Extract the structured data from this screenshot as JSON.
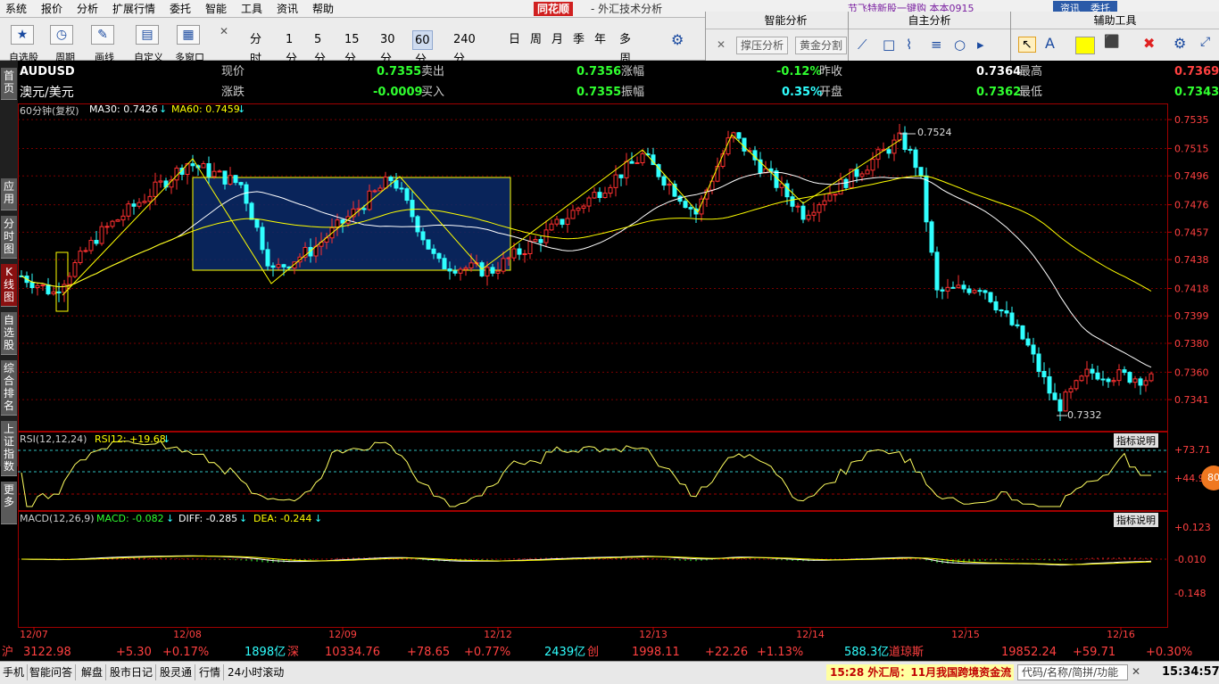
{
  "menu": {
    "items": [
      "系统",
      "报价",
      "分析",
      "扩展行情",
      "委托",
      "智能",
      "工具",
      "资讯",
      "帮助"
    ],
    "logo": "同花顺",
    "window_title": "- 外汇技术分析",
    "news": "节飞特新股一键购   本本0915",
    "tab1": "资讯",
    "tab2": "委托"
  },
  "toolbar": {
    "groups": [
      {
        "label": "自选股",
        "icon": "star-icon"
      },
      {
        "label": "周期",
        "icon": "clock-icon"
      },
      {
        "label": "画线",
        "icon": "pencil-icon"
      },
      {
        "label": "自定义",
        "icon": "layout-icon"
      },
      {
        "label": "多窗口",
        "icon": "windows-icon"
      }
    ]
  },
  "periods": [
    "分时",
    "1分",
    "5分",
    "15分",
    "30分",
    "60分",
    "240分钟",
    "日",
    "周",
    "月",
    "季",
    "年",
    "多周期"
  ],
  "selected_period": "60分",
  "panels": {
    "smart": {
      "title": "智能分析",
      "b1": "撑压分析",
      "b2": "黄金分割"
    },
    "self": {
      "title": "自主分析"
    },
    "aux": {
      "title": "辅助工具"
    }
  },
  "sidetabs": [
    "首页",
    "应用",
    "分时图",
    "K线图",
    "自选股",
    "综合排名",
    "上证指数",
    "更多"
  ],
  "quote": {
    "code": "AUDUSD",
    "name": "澳元/美元",
    "l_now": "现价",
    "v_now": "0.7355",
    "l_sell": "卖出",
    "v_sell": "0.7356",
    "l_chg_pct": "涨幅",
    "v_chg_pct": "-0.12%",
    "l_prev": "昨收",
    "v_prev": "0.7364",
    "l_high": "最高",
    "v_high": "0.7369",
    "l_chg": "涨跌",
    "v_chg": "-0.0009",
    "l_buy": "买入",
    "v_buy": "0.7355",
    "l_amp": "振幅",
    "v_amp": "0.35%",
    "l_open": "开盘",
    "v_open": "0.7362",
    "l_low": "最低",
    "v_low": "0.7343"
  },
  "ma_label": "60分钟(复权)",
  "ma30_label": "MA30: 0.7426",
  "ma60_label": "MA60: 0.7459",
  "price_axis": [
    "0.7535",
    "0.7515",
    "0.7496",
    "0.7476",
    "0.7457",
    "0.7438",
    "0.7418",
    "0.7399",
    "0.7380",
    "0.7360",
    "0.7341"
  ],
  "annot_high": "0.7524",
  "annot_low": "0.7332",
  "rsi": {
    "label": "RSI(12,12,24)",
    "value": "RSI12: +19.68",
    "axis": [
      "+73.71",
      "+44.97"
    ],
    "help": "指标说明",
    "badge": "80"
  },
  "macd": {
    "label": "MACD(12,26,9)",
    "macd": "MACD: -0.082",
    "diff": "DIFF: -0.285",
    "dea": "DEA: -0.244",
    "axis": [
      "+0.123",
      "-0.010",
      "-0.148"
    ],
    "help": "指标说明"
  },
  "dates": [
    "12/07",
    "12/08",
    "12/09",
    "12/12",
    "12/13",
    "12/14",
    "12/15",
    "12/16"
  ],
  "colors": {
    "up": "#ff3030",
    "down": "#30ffff",
    "ma30": "#ffffff",
    "ma60": "#ffff00",
    "grid": "#7a0000"
  },
  "chart_data": {
    "type": "candlestick",
    "title": "AUDUSD 60分钟",
    "ylim": [
      0.7325,
      0.754
    ],
    "ma30_last": 0.7426,
    "ma60_last": 0.7459,
    "high": 0.7524,
    "low": 0.7332,
    "x": [
      "12/07",
      "12/08",
      "12/09",
      "12/12",
      "12/13",
      "12/14",
      "12/15",
      "12/16"
    ]
  },
  "footer": {
    "sh_l": "沪",
    "sh_v": "3122.98",
    "sh_c": "+5.30",
    "sh_p": "+0.17%",
    "sh_vol": "1898亿",
    "sz_l": "深",
    "sz_v": "10334.76",
    "sz_c": "+78.65",
    "sz_p": "+0.77%",
    "sz_vol": "2439亿",
    "cy_l": "创",
    "cy_v": "1998.11",
    "cy_c": "+22.26",
    "cy_p": "+1.13%",
    "cy_vol": "588.3亿",
    "dj_l": "道琼斯",
    "dj_v": "19852.24",
    "dj_c": "+59.71",
    "dj_p": "+0.30%"
  },
  "bottombar": {
    "items": [
      "手机",
      "智能问答",
      "解盘",
      "股市日记",
      "股灵通",
      "行情",
      "24小时滚动"
    ],
    "ticker": "15:28 外汇局：11月我国跨境资金流",
    "search": "代码/名称/简拼/功能",
    "time": "15:34:57"
  }
}
